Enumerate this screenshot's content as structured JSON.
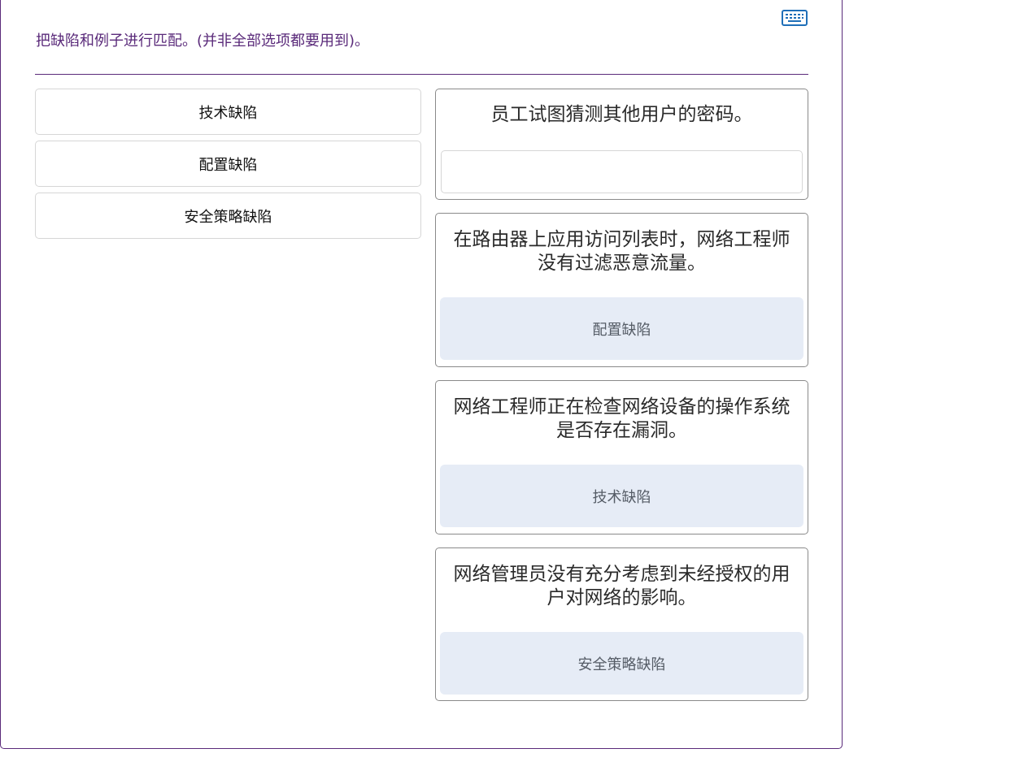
{
  "instruction": "把缺陷和例子进行匹配。(并非全部选项都要用到)。",
  "keyboard_icon": "keyboard-icon",
  "options": [
    {
      "label": "技术缺陷"
    },
    {
      "label": "配置缺陷"
    },
    {
      "label": "安全策略缺陷"
    }
  ],
  "targets": [
    {
      "text": "员工试图猜测其他用户的密码。",
      "answer": ""
    },
    {
      "text": "在路由器上应用访问列表时，网络工程师没有过滤恶意流量。",
      "answer": "配置缺陷"
    },
    {
      "text": "网络工程师正在检查网络设备的操作系统是否存在漏洞。",
      "answer": "技术缺陷"
    },
    {
      "text": "网络管理员没有充分考虑到未经授权的用户对网络的影响。",
      "answer": "安全策略缺陷"
    }
  ],
  "colors": {
    "accent": "#5a2a7a",
    "filled_drop": "#e6ecf6",
    "icon_blue": "#1f6fb8"
  }
}
